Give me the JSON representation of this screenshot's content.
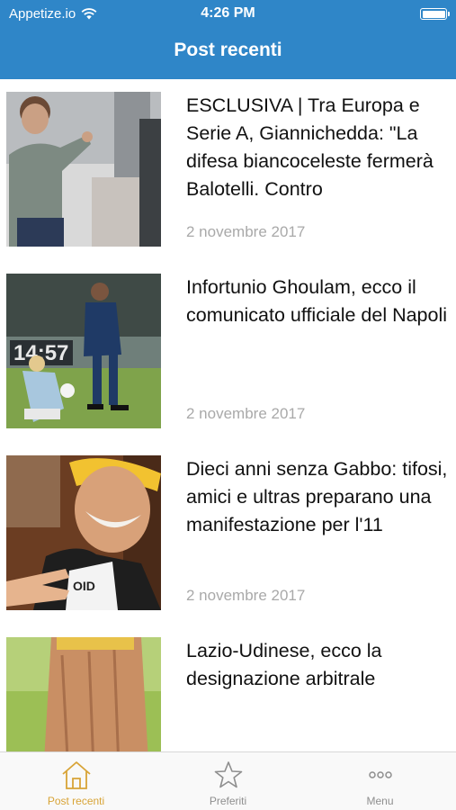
{
  "status_bar": {
    "carrier": "Appetize.io",
    "time": "4:26 PM"
  },
  "nav": {
    "title": "Post recenti"
  },
  "posts": [
    {
      "title": "ESCLUSIVA | Tra Europa e Serie A, Giannichedda: \"La difesa biancoceleste fermerà Balotelli. Contro",
      "date": "2 novembre 2017"
    },
    {
      "title": "Infortunio Ghoulam, ecco il comunicato ufficiale del Napoli",
      "date": "2 novembre 2017"
    },
    {
      "title": "Dieci anni senza Gabbo: tifosi, amici e ultras preparano una manifestazione per l'11",
      "date": "2 novembre 2017"
    },
    {
      "title": "Lazio-Udinese, ecco la designazione arbitrale",
      "date": ""
    }
  ],
  "tabbar": {
    "tabs": [
      {
        "label": "Post recenti",
        "icon": "home-icon",
        "active": true
      },
      {
        "label": "Preferiti",
        "icon": "star-icon",
        "active": false
      },
      {
        "label": "Menu",
        "icon": "more-icon",
        "active": false
      }
    ]
  },
  "colors": {
    "header": "#2f86c8",
    "tab_active": "#d8a437",
    "tab_inactive": "#8e8e8e",
    "date": "#a9a9a9"
  }
}
